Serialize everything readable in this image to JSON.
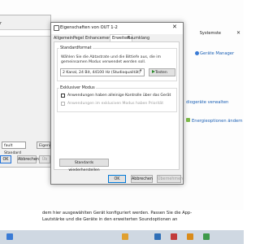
{
  "background": {
    "window_title": "Systemste",
    "close_glyph": "✕",
    "link_geraete": "Geräte Manager",
    "link_audio": "diogeräte verwalten",
    "link_energie": "Energieoptionen ändern",
    "bottom_text_line1": "dem hier ausgewählten Gerät konfiguriert werden. Passen Sie die App-",
    "bottom_text_line2": "Lautstärke und die Geräte in den erweiterten Soundoptionen an",
    "colors": {
      "link": "#1a5fb4",
      "taskbar": "#cfd8e2"
    }
  },
  "left_dialog": {
    "title": "r",
    "select_value": "fault Standard",
    "select2_value": "Eigens",
    "ok_label": "OK",
    "cancel_label": "Abbrechen",
    "apply_label": "Üb"
  },
  "dialog": {
    "title": "Eigenschaften von OUT 1-2",
    "close_glyph": "✕",
    "tabs": [
      {
        "label": "Allgemein",
        "active": false
      },
      {
        "label": "Pegel",
        "active": false
      },
      {
        "label": "Enhancements",
        "active": false
      },
      {
        "label": "Erweitert",
        "active": true
      },
      {
        "label": "Raumklang",
        "active": false
      }
    ],
    "standard_format": {
      "title": "Standardformat",
      "description": "Wählen Sie die Abtastrate und die Bittiefe aus, die im gemeinsamen Modus verwendet werden soll.",
      "selected_format": "2 Kanal, 24 Bit, 44100 Hz (Studioqualität)",
      "test_label": "Testen"
    },
    "exclusive_mode": {
      "title": "Exklusiver Modus",
      "option1": "Anwendungen haben alleinige Kontrolle über das Gerät",
      "option2": "Anwendungen im exklusiven Modus haben Priorität",
      "option1_checked": false,
      "option2_checked": false,
      "option2_disabled": true
    },
    "restore_defaults_label": "Standards wiederherstellen",
    "ok_label": "OK",
    "cancel_label": "Abbrechen",
    "apply_label": "Übernehmen"
  }
}
